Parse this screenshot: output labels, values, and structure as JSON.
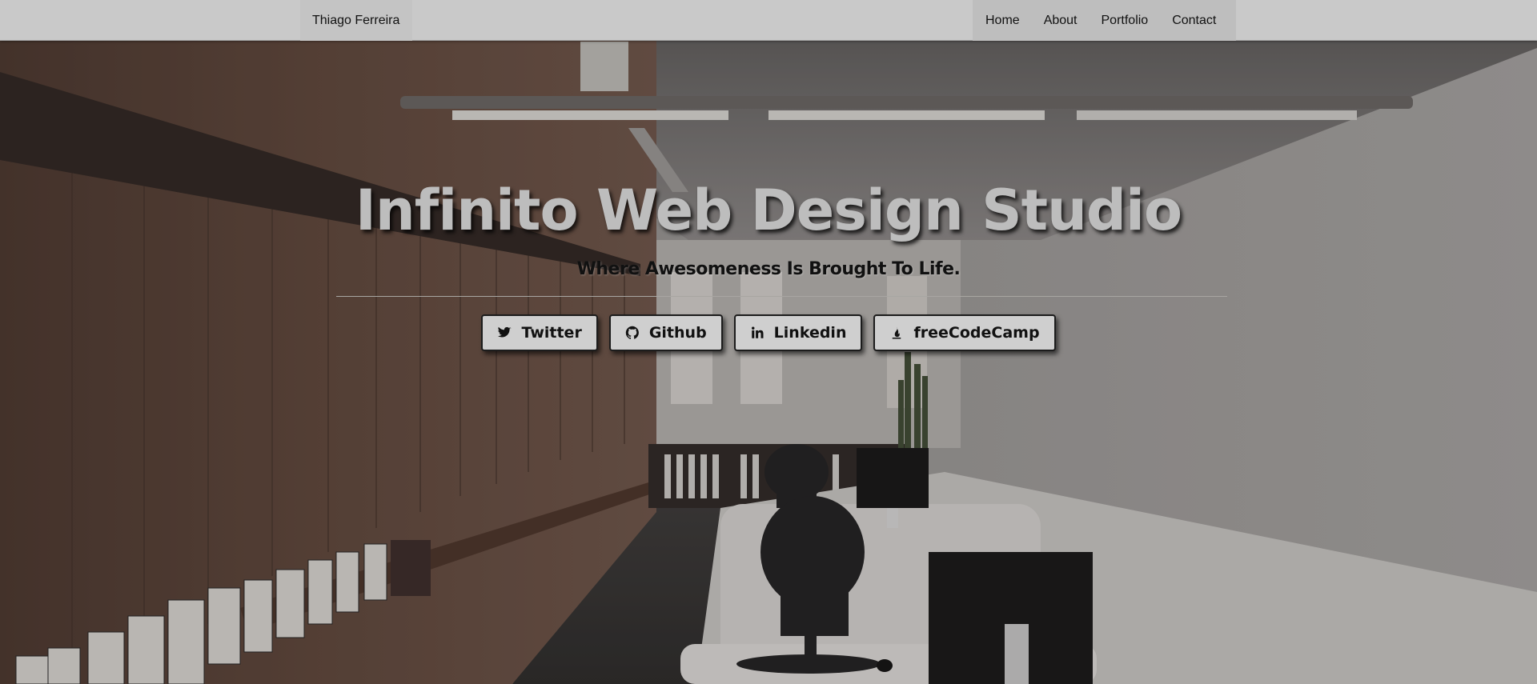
{
  "navbar": {
    "brand": "Thiago Ferreira",
    "links": [
      "Home",
      "About",
      "Portfolio",
      "Contact"
    ]
  },
  "hero": {
    "title": "Infinito Web Design Studio",
    "subtitle": "Where Awesomeness Is Brought To Life."
  },
  "social": [
    {
      "label": "Twitter",
      "icon": "twitter-icon"
    },
    {
      "label": "Github",
      "icon": "github-icon"
    },
    {
      "label": "Linkedin",
      "icon": "linkedin-icon"
    },
    {
      "label": "freeCodeCamp",
      "icon": "fire-icon"
    }
  ],
  "colors": {
    "navbar_bg": "#c9c9c9",
    "nav_links_bg": "#bebebe",
    "title_text": "#bdbdbd",
    "button_bg": "#cfcfcf",
    "button_border": "#1c1c1c"
  }
}
